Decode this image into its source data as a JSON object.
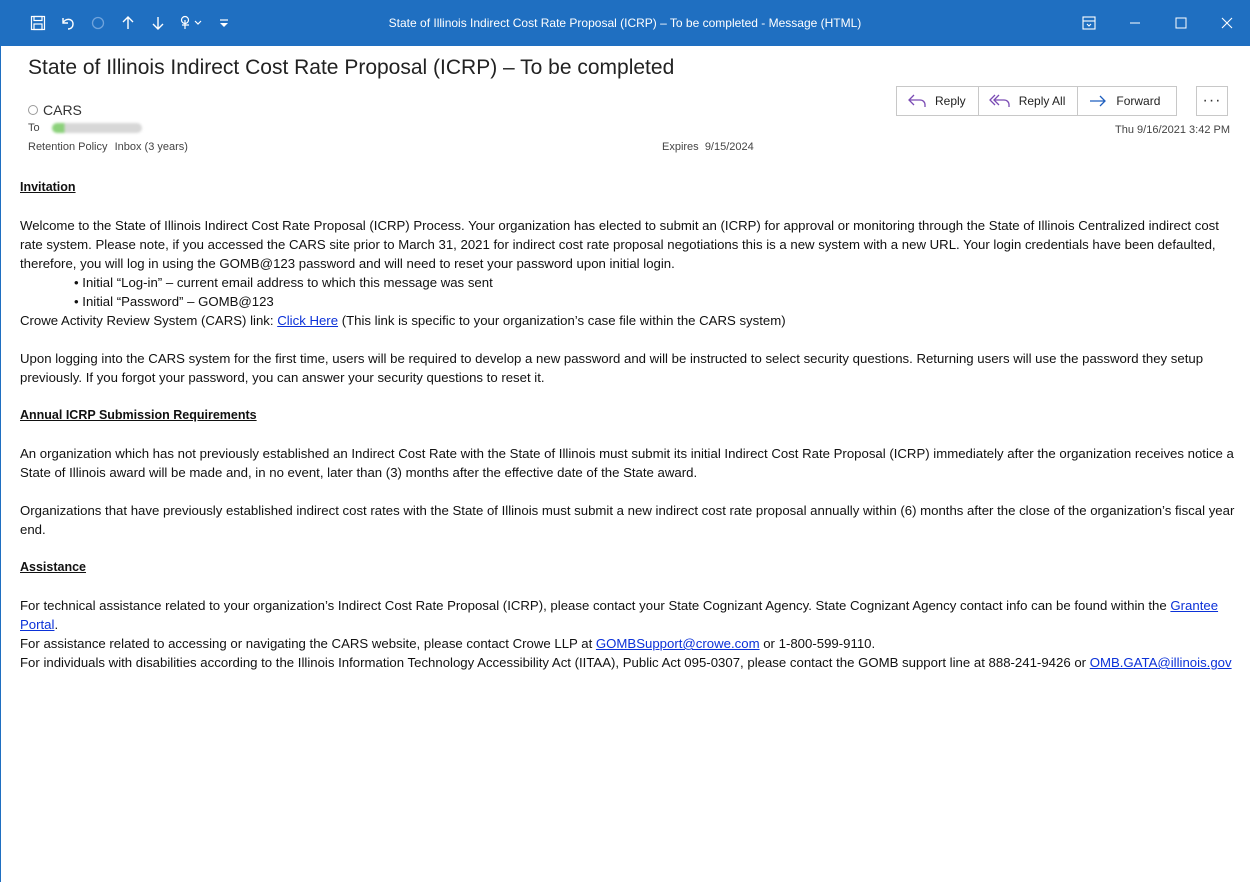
{
  "window": {
    "title": "State of Illinois Indirect Cost Rate Proposal (ICRP) – To be completed  -  Message (HTML)",
    "titlebar_color": "#1f6fc1",
    "quick_access": [
      "save-icon",
      "undo-icon",
      "redo-icon",
      "up-arrow-icon",
      "down-arrow-icon",
      "touch-mode-icon",
      "customize-icon"
    ]
  },
  "message": {
    "subject": "State of Illinois Indirect Cost Rate Proposal (ICRP) – To be completed",
    "sender": "CARS",
    "to_label": "To",
    "retention_label": "Retention Policy",
    "retention_value": "Inbox (3 years)",
    "expires_label": "Expires",
    "expires_value": "9/15/2024",
    "date": "Thu 9/16/2021 3:42 PM"
  },
  "actions": {
    "reply": "Reply",
    "reply_all": "Reply All",
    "forward": "Forward",
    "more": "···"
  },
  "body": {
    "invitation_heading": "Invitation",
    "welcome": "Welcome to the State of Illinois Indirect Cost Rate Proposal (ICRP) Process. Your organization has elected to submit an (ICRP) for approval or monitoring through the State of Illinois Centralized indirect cost rate system. Please note, if you accessed the CARS site prior to March 31, 2021 for indirect cost rate proposal negotiations this is a new system with a new URL. Your login credentials have been defaulted, therefore, you will log in using the GOMB@123 password and will need to reset your password upon initial login.",
    "bullet1": "• Initial “Log-in” – current email address to which this message was sent",
    "bullet2": "• Initial “Password” – GOMB@123",
    "cars_link_prefix": "Crowe Activity Review System (CARS) link: ",
    "cars_link_text": "Click Here",
    "cars_link_suffix": " (This link is specific to your organization’s case file within the CARS system)",
    "logging_in": "Upon logging into the CARS system for the first time, users will be required to develop a new password and will be instructed to select security questions. Returning users will use the password they setup previously. If you forgot your password, you can answer your security questions to reset it.",
    "annual_heading": "Annual ICRP Submission Requirements",
    "annual_p1": "An organization which has not previously established an Indirect Cost Rate with the State of Illinois must submit its initial Indirect Cost Rate Proposal (ICRP) immediately after the organization receives notice a State of Illinois award will be made and, in no event, later than (3) months after the effective date of the State award.",
    "annual_p2": "Organizations that have previously established indirect cost rates with the State of Illinois must submit a new indirect cost rate proposal annually within (6) months after the close of the organization’s fiscal year end.",
    "assistance_heading": "Assistance",
    "assist1_prefix": "For technical assistance related to your organization’s Indirect Cost Rate Proposal (ICRP), please contact your State Cognizant Agency. State Cognizant Agency contact info can be found within the ",
    "assist1_link": "Grantee Portal",
    "assist1_suffix": ".",
    "assist2_prefix": "For assistance related to accessing or navigating the CARS website, please contact Crowe LLP at ",
    "assist2_link": "GOMBSupport@crowe.com",
    "assist2_suffix": " or 1-800-599-9110.",
    "assist3_prefix": "For individuals with disabilities according to the Illinois Information Technology Accessibility Act (IITAA), Public Act 095-0307, please contact the GOMB support line at 888-241-9426 or ",
    "assist3_link": "OMB.GATA@illinois.gov"
  }
}
